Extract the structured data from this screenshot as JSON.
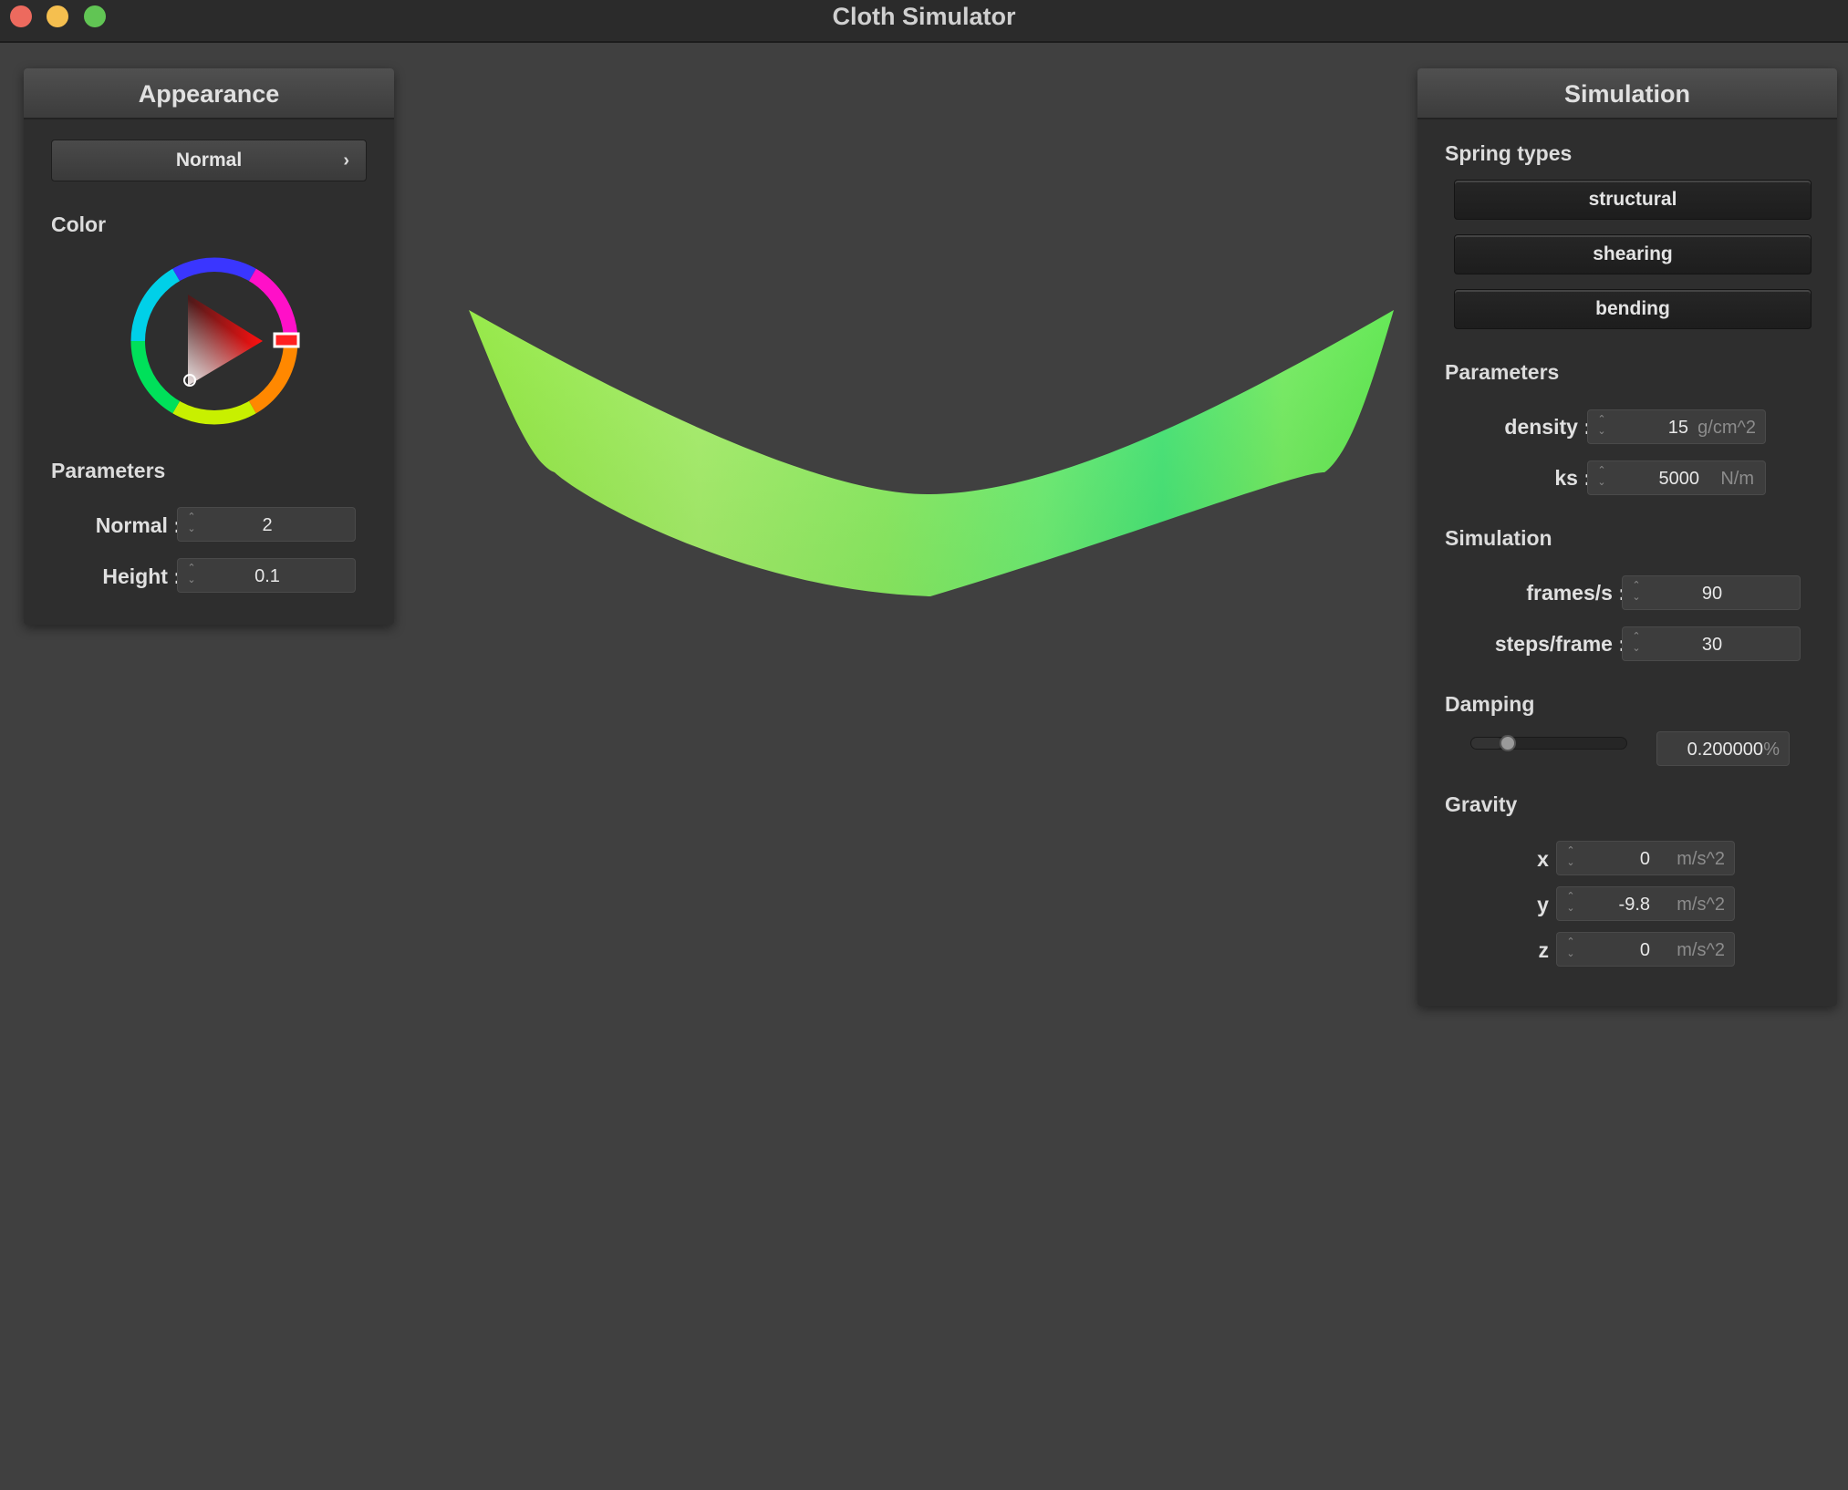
{
  "window": {
    "title": "Cloth Simulator"
  },
  "appearance": {
    "header": "Appearance",
    "shader_select": {
      "value": "Normal"
    },
    "color_label": "Color",
    "selected_color": "#ff0000",
    "parameters_label": "Parameters",
    "normal": {
      "label": "Normal :",
      "value": "2"
    },
    "height": {
      "label": "Height :",
      "value": "0.1"
    }
  },
  "simulation": {
    "header": "Simulation",
    "spring_types_label": "Spring types",
    "spring_buttons": [
      "structural",
      "shearing",
      "bending"
    ],
    "parameters_label": "Parameters",
    "density": {
      "label": "density :",
      "value": "15",
      "unit": "g/cm^2"
    },
    "ks": {
      "label": "ks :",
      "value": "5000",
      "unit": "N/m"
    },
    "simulation_label": "Simulation",
    "fps": {
      "label": "frames/s :",
      "value": "90"
    },
    "steps": {
      "label": "steps/frame :",
      "value": "30"
    },
    "damping_label": "Damping",
    "damping": {
      "value": "0.200000",
      "unit": "%",
      "slider_fraction": 0.2
    },
    "gravity_label": "Gravity",
    "gravity_x": {
      "label": "x :",
      "value": "0",
      "unit": "m/s^2"
    },
    "gravity_y": {
      "label": "y :",
      "value": "-9.8",
      "unit": "m/s^2"
    },
    "gravity_z": {
      "label": "z :",
      "value": "0",
      "unit": "m/s^2"
    }
  },
  "viewport": {
    "cloth_color": "#7fe84a"
  }
}
